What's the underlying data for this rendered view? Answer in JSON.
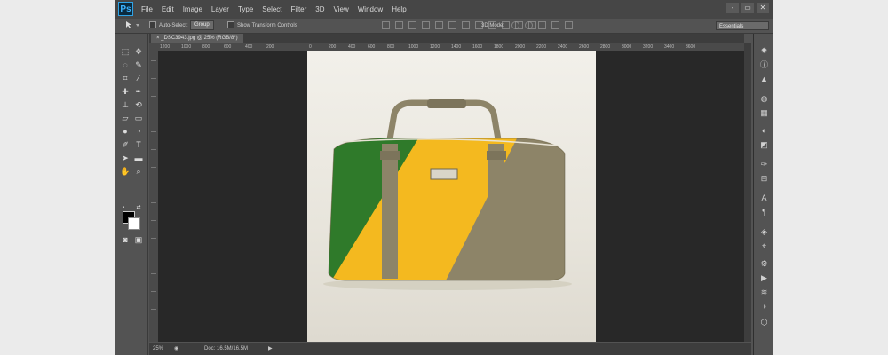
{
  "app": {
    "logo": "Ps",
    "menu": [
      "File",
      "Edit",
      "Image",
      "Layer",
      "Type",
      "Select",
      "Filter",
      "3D",
      "View",
      "Window",
      "Help"
    ],
    "window_controls": [
      "-",
      "▭",
      "✕"
    ]
  },
  "options": {
    "auto_select_label": "Auto-Select:",
    "auto_select_value": "Group",
    "show_transform_label": "Show Transform Controls",
    "mode_3d_label": "3D Mode:",
    "workspace": "Essentials"
  },
  "document": {
    "tab_label": "_DSC3943.jpg @ 25% (RGB/8*)",
    "ruler_labels": [
      "1200",
      "1000",
      "800",
      "600",
      "400",
      "200",
      "0",
      "200",
      "400",
      "600",
      "800",
      "1000",
      "1200",
      "1400",
      "1600",
      "1800",
      "2000",
      "2200",
      "2400",
      "2600",
      "2800",
      "3000",
      "3200",
      "3400",
      "3600"
    ]
  },
  "status": {
    "zoom": "25%",
    "doc_info": "Doc: 16.5M/16.5M"
  },
  "colors": {
    "bag_green": "#2f7a2a",
    "bag_yellow": "#f4b91f",
    "bag_taupe": "#8d8468",
    "fg_color": "#000000",
    "bg_color": "#ffffff"
  },
  "tool_icons": [
    "move-tool-icon",
    "marquee-tool-icon",
    "lasso-tool-icon",
    "quick-select-tool-icon",
    "crop-tool-icon",
    "eyedropper-tool-icon",
    "healing-brush-icon",
    "brush-tool-icon",
    "clone-stamp-icon",
    "history-brush-icon",
    "eraser-tool-icon",
    "gradient-tool-icon",
    "blur-tool-icon",
    "dodge-tool-icon",
    "pen-tool-icon",
    "type-tool-icon",
    "path-select-icon",
    "rectangle-tool-icon",
    "hand-tool-icon",
    "zoom-tool-icon"
  ]
}
